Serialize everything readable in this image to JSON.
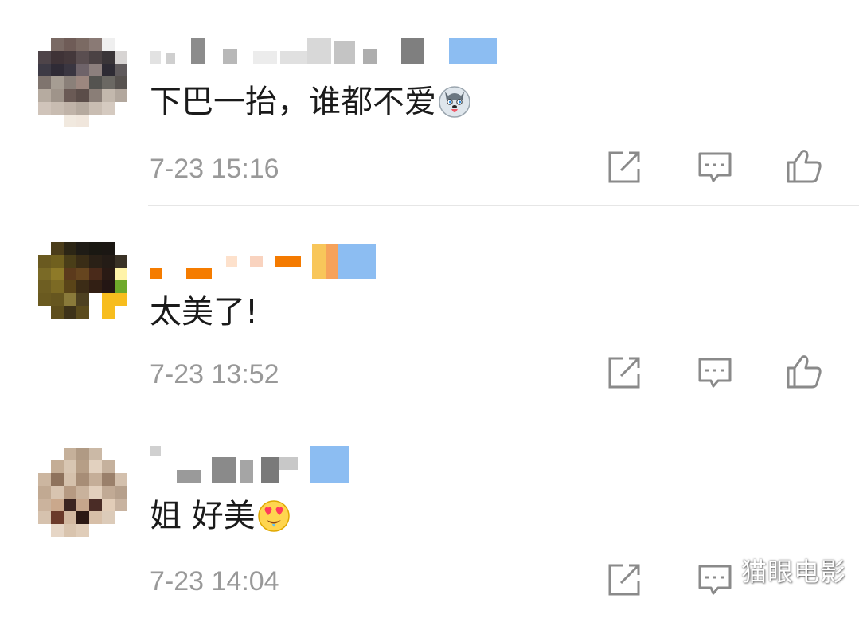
{
  "comments": [
    {
      "text": "下巴一抬，谁都不爱",
      "emoji": "husky-emoji",
      "timestamp": "7-23 15:16"
    },
    {
      "text": "太美了!",
      "emoji": "",
      "timestamp": "7-23 13:52"
    },
    {
      "text": "姐 好美",
      "emoji": "heart-eyes-emoji",
      "timestamp": "7-23 14:04"
    }
  ],
  "actions": {
    "share_icon": "share-icon",
    "reply_icon": "reply-icon",
    "like_icon": "like-icon"
  },
  "colors": {
    "timestamp": "#999999",
    "icon": "#8a8a8a",
    "divider": "#e6e6e6"
  },
  "watermark": "猫眼电影"
}
